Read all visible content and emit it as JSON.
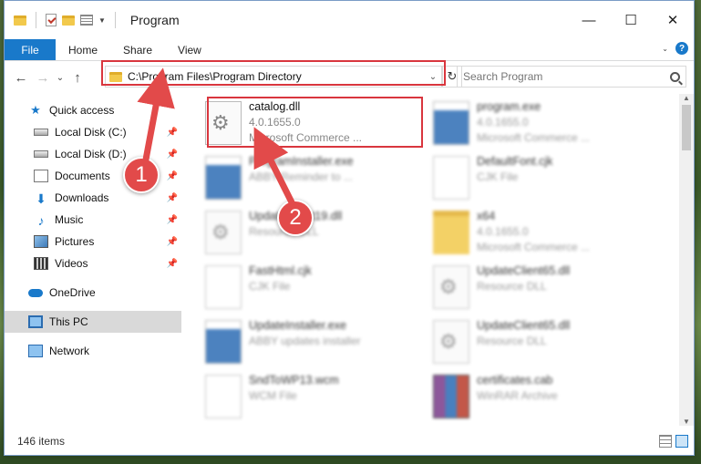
{
  "window": {
    "title": "Program",
    "controls": {
      "minimize": "—",
      "maximize": "☐",
      "close": "✕"
    }
  },
  "ribbon": {
    "file_tab": "File",
    "tabs": [
      "Home",
      "Share",
      "View"
    ],
    "expand_icon": "⌄",
    "help_icon": "?"
  },
  "navigation": {
    "back": "←",
    "forward": "→",
    "recent": "⌄",
    "up": "↑"
  },
  "address": {
    "path": "C:\\Program Files\\Program Directory",
    "caret": "⌄",
    "refresh": "↻"
  },
  "search": {
    "placeholder": "Search Program"
  },
  "nav_pane": {
    "quick_access": "Quick access",
    "items": [
      {
        "label": "Local Disk (C:)",
        "icon": "drive-icon"
      },
      {
        "label": "Local Disk (D:)",
        "icon": "drive-icon"
      },
      {
        "label": "Documents",
        "icon": "documents-icon"
      },
      {
        "label": "Downloads",
        "icon": "downloads-icon"
      },
      {
        "label": "Music",
        "icon": "music-icon"
      },
      {
        "label": "Pictures",
        "icon": "pictures-icon"
      },
      {
        "label": "Videos",
        "icon": "videos-icon"
      }
    ],
    "onedrive": "OneDrive",
    "this_pc": "This PC",
    "network": "Network",
    "pin_glyph": "📌"
  },
  "files": [
    {
      "name": "catalog.dll",
      "line1": "4.0.1655.0",
      "line2": "Microsoft Commerce ...",
      "kind": "dll",
      "highlight": true
    },
    {
      "name": "program.exe",
      "line1": "4.0.1655.0",
      "line2": "Microsoft Commerce ...",
      "kind": "exe"
    },
    {
      "name": "ProgramInstaller.exe",
      "line1": "ABBY Reminder to ...",
      "line2": "",
      "kind": "exe"
    },
    {
      "name": "DefaultFont.cjk",
      "line1": "CJK File",
      "line2": "",
      "kind": "cjk"
    },
    {
      "name": "UpdateClient19.dll",
      "line1": "Resource DLL",
      "line2": "",
      "kind": "dll"
    },
    {
      "name": "x64",
      "line1": "4.0.1655.0",
      "line2": "Microsoft Commerce ...",
      "kind": "folder"
    },
    {
      "name": "FastHtml.cjk",
      "line1": "CJK File",
      "line2": "",
      "kind": "cjk"
    },
    {
      "name": "UpdateClient65.dll",
      "line1": "Resource DLL",
      "line2": "",
      "kind": "dll"
    },
    {
      "name": "UpdateInstaller.exe",
      "line1": "ABBY updates installer",
      "line2": "",
      "kind": "exe"
    },
    {
      "name": "UpdateClient65.dll",
      "line1": "Resource DLL",
      "line2": "",
      "kind": "dll"
    },
    {
      "name": "SndToWP13.wcm",
      "line1": "WCM File",
      "line2": "",
      "kind": "cjk"
    },
    {
      "name": "certificates.cab",
      "line1": "WinRAR Archive",
      "line2": "",
      "kind": "rar"
    }
  ],
  "status": {
    "count": "146 items"
  },
  "callouts": {
    "one": "1",
    "two": "2"
  },
  "colors": {
    "accent": "#1979ca",
    "highlight": "#d9363e",
    "callout": "#e24a4a"
  }
}
